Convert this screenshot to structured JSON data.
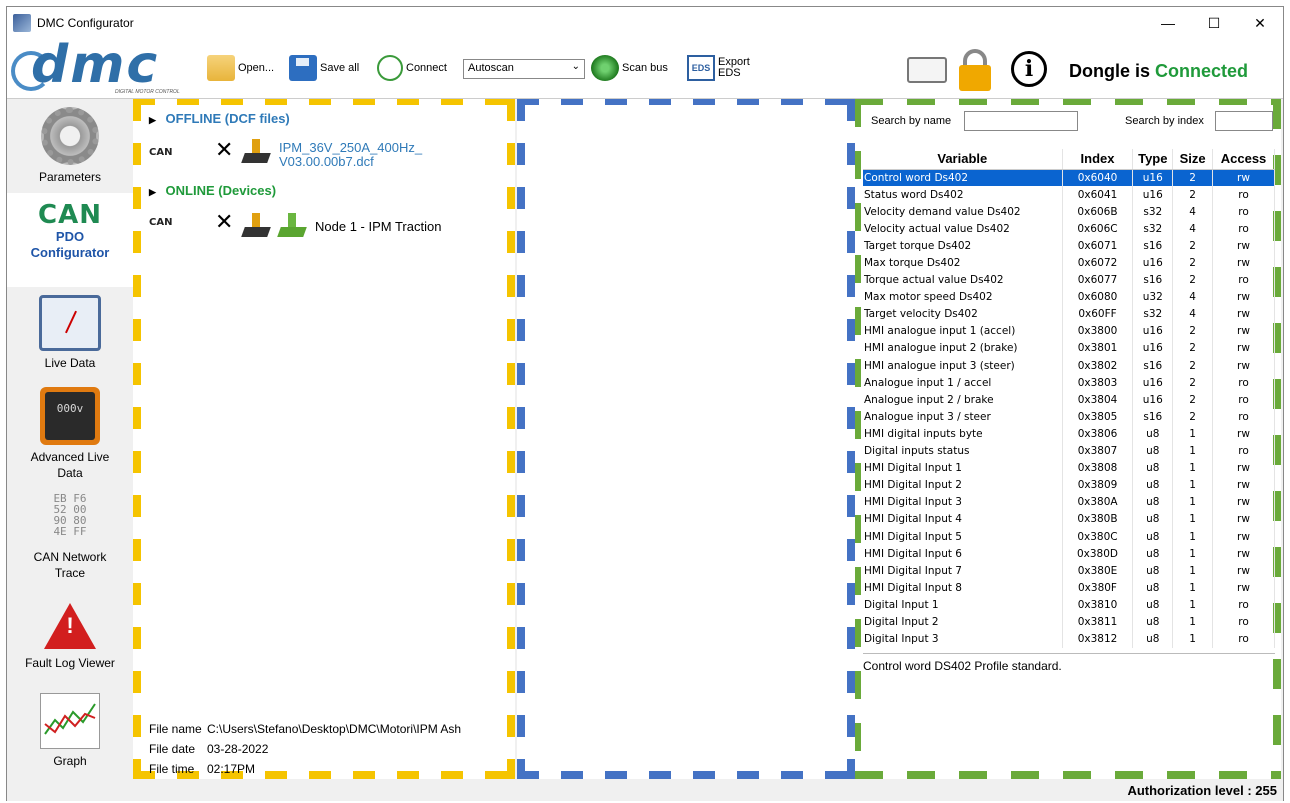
{
  "window": {
    "title": "DMC Configurator",
    "minimize": "—",
    "maximize": "☐",
    "close": "✕"
  },
  "toolbar": {
    "logo_text": "dmc",
    "logo_subtitle": "DIGITAL MOTOR CONTROL",
    "open_label": "Open...",
    "save_all_label": "Save all",
    "connect_label": "Connect",
    "autoscan_value": "Autoscan",
    "scan_bus_label": "Scan bus",
    "export_eds_label_1": "Export",
    "export_eds_label_2": "EDS",
    "eds_icon_text": "EDS",
    "dongle_prefix": "Dongle is",
    "dongle_status": "Connected",
    "info_glyph": "i"
  },
  "sidebar": {
    "parameters": "Parameters",
    "can_logo": "CAN",
    "pdo_line1": "PDO",
    "pdo_line2": "Configurator",
    "live_data": "Live Data",
    "adv_display": "000v",
    "adv_line1": "Advanced Live",
    "adv_line2": "Data",
    "trace_hex": "EB F6 52 00 90 80 4E FF",
    "trace_line1": "CAN Network",
    "trace_line2": "Trace",
    "warn_glyph": "!",
    "fault_log": "Fault Log Viewer",
    "graph": "Graph"
  },
  "tree": {
    "offline_label": "OFFLINE (DCF files)",
    "can_tag_1": "CAN",
    "dcf_line1": "IPM_36V_250A_400Hz_",
    "dcf_line2": "V03.00.00b7.dcf",
    "online_label": "ONLINE (Devices)",
    "can_tag_2": "CAN",
    "node_name": "Node 1 - IPM Traction",
    "x_mark": "✕"
  },
  "file_info": {
    "name_key": "File name",
    "name_val": "C:\\Users\\Stefano\\Desktop\\DMC\\Motori\\IPM Ash",
    "date_key": "File date",
    "date_val": "03-28-2022",
    "time_key": "File time",
    "time_val": "02:17PM"
  },
  "search": {
    "by_name": "Search by name",
    "by_index": "Search by index"
  },
  "table": {
    "headers": [
      "Variable",
      "Index",
      "Type",
      "Size",
      "Access"
    ],
    "rows": [
      [
        "Control word Ds402",
        "0x6040",
        "u16",
        "2",
        "rw"
      ],
      [
        "Status word Ds402",
        "0x6041",
        "u16",
        "2",
        "ro"
      ],
      [
        "Velocity demand value Ds402",
        "0x606B",
        "s32",
        "4",
        "ro"
      ],
      [
        "Velocity actual value Ds402",
        "0x606C",
        "s32",
        "4",
        "ro"
      ],
      [
        "Target torque Ds402",
        "0x6071",
        "s16",
        "2",
        "rw"
      ],
      [
        "Max torque Ds402",
        "0x6072",
        "u16",
        "2",
        "rw"
      ],
      [
        "Torque actual value Ds402",
        "0x6077",
        "s16",
        "2",
        "ro"
      ],
      [
        "Max motor speed Ds402",
        "0x6080",
        "u32",
        "4",
        "rw"
      ],
      [
        "Target velocity Ds402",
        "0x60FF",
        "s32",
        "4",
        "rw"
      ],
      [
        "HMI analogue input 1 (accel)",
        "0x3800",
        "u16",
        "2",
        "rw"
      ],
      [
        "HMI analogue input 2 (brake)",
        "0x3801",
        "u16",
        "2",
        "rw"
      ],
      [
        "HMI analogue input 3 (steer)",
        "0x3802",
        "s16",
        "2",
        "rw"
      ],
      [
        "Analogue input 1 / accel",
        "0x3803",
        "u16",
        "2",
        "ro"
      ],
      [
        "Analogue input 2 / brake",
        "0x3804",
        "u16",
        "2",
        "ro"
      ],
      [
        "Analogue input 3 / steer",
        "0x3805",
        "s16",
        "2",
        "ro"
      ],
      [
        "HMI digital inputs byte",
        "0x3806",
        "u8",
        "1",
        "rw"
      ],
      [
        "Digital inputs status",
        "0x3807",
        "u8",
        "1",
        "ro"
      ],
      [
        "HMI Digital Input 1",
        "0x3808",
        "u8",
        "1",
        "rw"
      ],
      [
        "HMI Digital Input 2",
        "0x3809",
        "u8",
        "1",
        "rw"
      ],
      [
        "HMI Digital Input 3",
        "0x380A",
        "u8",
        "1",
        "rw"
      ],
      [
        "HMI Digital Input 4",
        "0x380B",
        "u8",
        "1",
        "rw"
      ],
      [
        "HMI Digital Input 5",
        "0x380C",
        "u8",
        "1",
        "rw"
      ],
      [
        "HMI Digital Input 6",
        "0x380D",
        "u8",
        "1",
        "rw"
      ],
      [
        "HMI Digital Input 7",
        "0x380E",
        "u8",
        "1",
        "rw"
      ],
      [
        "HMI Digital Input 8",
        "0x380F",
        "u8",
        "1",
        "rw"
      ],
      [
        "Digital Input 1",
        "0x3810",
        "u8",
        "1",
        "ro"
      ],
      [
        "Digital Input 2",
        "0x3811",
        "u8",
        "1",
        "ro"
      ],
      [
        "Digital Input 3",
        "0x3812",
        "u8",
        "1",
        "ro"
      ]
    ],
    "selected_index": 0
  },
  "description": "Control word DS402 Profile standard.",
  "status": {
    "authorization": "Authorization level :  255"
  },
  "colors": {
    "accent_green": "#1f9a3a",
    "accent_blue": "#2f7ab8",
    "selection": "#0a64d0",
    "dash_yellow": "#f5c400",
    "dash_blue": "#4472c4",
    "dash_green": "#6aaa3a"
  },
  "icons": [
    "app-icon",
    "folder-icon",
    "floppy-icon",
    "connect-icon",
    "chevron-down-icon",
    "radar-icon",
    "eds-icon",
    "book-icon",
    "lock-icon",
    "info-icon",
    "gear-icon",
    "meter-icon",
    "display-icon",
    "hex-trace-icon",
    "warning-icon",
    "graph-icon",
    "chip-icon"
  ]
}
